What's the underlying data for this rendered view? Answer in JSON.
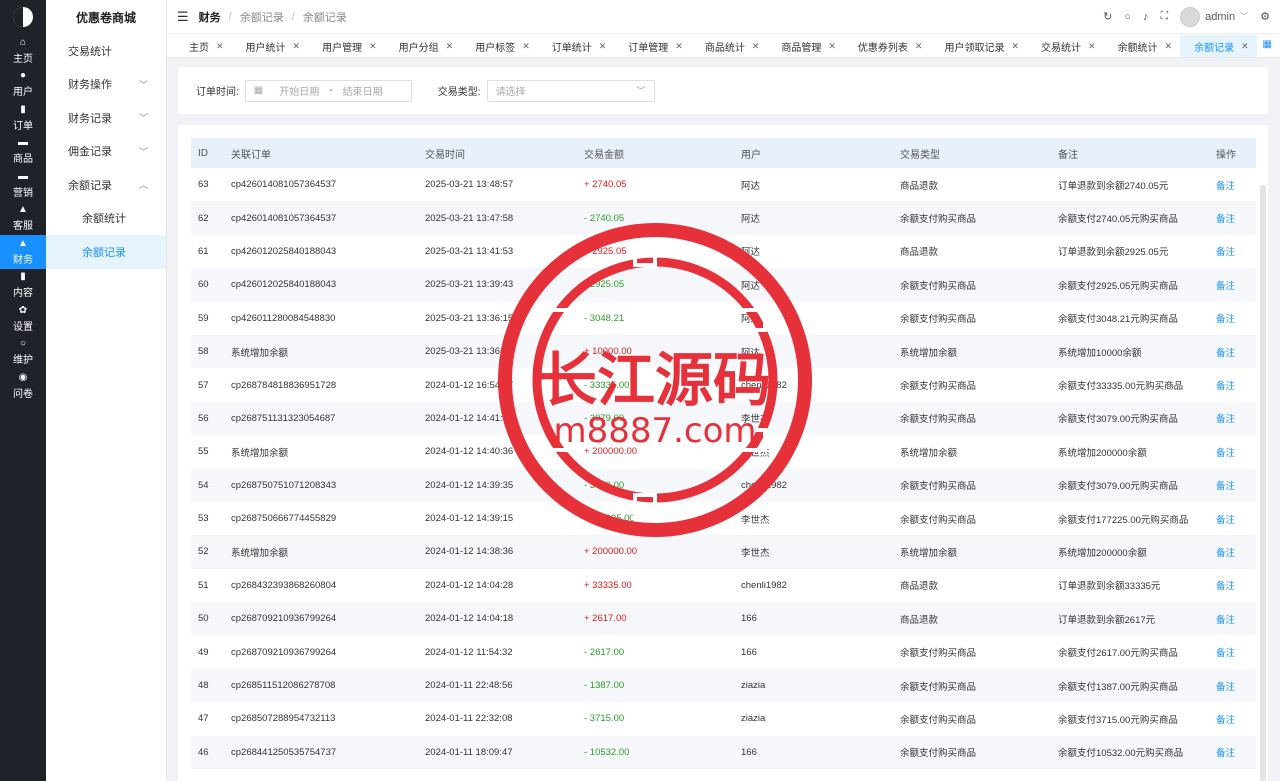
{
  "rail": {
    "logo_icon": "logo-icon",
    "items": [
      {
        "label": "主页",
        "icon": "⌂"
      },
      {
        "label": "用户",
        "icon": "●"
      },
      {
        "label": "订单",
        "icon": "▮"
      },
      {
        "label": "商品",
        "icon": "▬"
      },
      {
        "label": "营销",
        "icon": "▬"
      },
      {
        "label": "客服",
        "icon": "▲"
      },
      {
        "label": "财务",
        "icon": "▲"
      },
      {
        "label": "内容",
        "icon": "▮"
      },
      {
        "label": "设置",
        "icon": "✿"
      },
      {
        "label": "维护",
        "icon": "○"
      },
      {
        "label": "问卷",
        "icon": "◉"
      }
    ],
    "active_index": 6
  },
  "submenu": {
    "brand": "优惠卷商城",
    "items": [
      {
        "label": "交易统计",
        "chevron": ""
      },
      {
        "label": "财务操作",
        "chevron": "﹀"
      },
      {
        "label": "财务记录",
        "chevron": "﹀"
      },
      {
        "label": "佣金记录",
        "chevron": "﹀"
      },
      {
        "label": "余额记录",
        "chevron": "︿"
      },
      {
        "label": "余额统计",
        "chevron": ""
      },
      {
        "label": "余额记录",
        "chevron": ""
      }
    ]
  },
  "header": {
    "menu_icon": "☰",
    "crumbs": [
      "财务",
      "余额记录",
      "余额记录"
    ],
    "crumb_sep": "/",
    "icons": {
      "refresh": "↻",
      "search": "○",
      "bell": "♪",
      "fullscreen": "⛶",
      "settings": "⚙"
    },
    "user": "admin",
    "user_chevron": "﹀"
  },
  "tabs": {
    "close": "✕",
    "grid_icon": "▦",
    "items": [
      "主页",
      "用户统计",
      "用户管理",
      "用户分组",
      "用户标签",
      "订单统计",
      "订单管理",
      "商品统计",
      "商品管理",
      "优惠券列表",
      "用户领取记录",
      "交易统计",
      "余额统计",
      "余额记录"
    ],
    "active_index": 13
  },
  "filter": {
    "order_time_label": "订单时间:",
    "cal_icon": "▦",
    "start_placeholder": "开始日期",
    "dash": "-",
    "end_placeholder": "结束日期",
    "type_label": "交易类型:",
    "type_placeholder": "请选择",
    "type_chevron": "﹀"
  },
  "table": {
    "columns": [
      "ID",
      "关联订单",
      "交易时间",
      "交易金额",
      "用户",
      "交易类型",
      "备注",
      "操作"
    ],
    "rows": [
      {
        "id": "63",
        "order": "cp426014081057364537",
        "time": "2025-03-21 13:48:57",
        "amount": "+ 2740.05",
        "sign": "plus",
        "user": "阿达",
        "type": "商品退款",
        "note": "订单退款到余额2740.05元",
        "op": "备注"
      },
      {
        "id": "62",
        "order": "cp426014081057364537",
        "time": "2025-03-21 13:47:58",
        "amount": "- 2740.05",
        "sign": "minus",
        "user": "阿达",
        "type": "余额支付购买商品",
        "note": "余额支付2740.05元购买商品",
        "op": "备注"
      },
      {
        "id": "61",
        "order": "cp426012025840188043",
        "time": "2025-03-21 13:41:53",
        "amount": "+ 2925.05",
        "sign": "plus",
        "user": "阿达",
        "type": "商品退款",
        "note": "订单退款到余额2925.05元",
        "op": "备注"
      },
      {
        "id": "60",
        "order": "cp426012025840188043",
        "time": "2025-03-21 13:39:43",
        "amount": "- 2925.05",
        "sign": "minus",
        "user": "阿达",
        "type": "余额支付购买商品",
        "note": "余额支付2925.05元购买商品",
        "op": "备注"
      },
      {
        "id": "59",
        "order": "cp426011280084548830",
        "time": "2025-03-21 13:36:15",
        "amount": "- 3048.21",
        "sign": "minus",
        "user": "阿达",
        "type": "余额支付购买商品",
        "note": "余额支付3048.21元购买商品",
        "op": "备注"
      },
      {
        "id": "58",
        "order": "系统增加余额",
        "time": "2025-03-21 13:36:17",
        "amount": "+ 10000.00",
        "sign": "plus",
        "user": "阿达",
        "type": "系统增加余额",
        "note": "系统增加10000余额",
        "op": "备注"
      },
      {
        "id": "57",
        "order": "cp268784818836951728",
        "time": "2024-01-12 16:54:57",
        "amount": "- 33335.00",
        "sign": "minus",
        "user": "chenli1982",
        "type": "余额支付购买商品",
        "note": "余额支付33335.00元购买商品",
        "op": "备注"
      },
      {
        "id": "56",
        "order": "cp268751131323054687",
        "time": "2024-01-12 14:41:05",
        "amount": "- 3079.00",
        "sign": "minus",
        "user": "李世杰",
        "type": "余额支付购买商品",
        "note": "余额支付3079.00元购买商品",
        "op": "备注"
      },
      {
        "id": "55",
        "order": "系统增加余额",
        "time": "2024-01-12 14:40:36",
        "amount": "+ 200000.00",
        "sign": "plus",
        "user": "李世杰",
        "type": "系统增加余额",
        "note": "系统增加200000余额",
        "op": "备注"
      },
      {
        "id": "54",
        "order": "cp268750751071208343",
        "time": "2024-01-12 14:39:35",
        "amount": "- 3079.00",
        "sign": "minus",
        "user": "chenli1982",
        "type": "余额支付购买商品",
        "note": "余额支付3079.00元购买商品",
        "op": "备注"
      },
      {
        "id": "53",
        "order": "cp268750666774455829",
        "time": "2024-01-12 14:39:15",
        "amount": "- 177225.00",
        "sign": "minus",
        "user": "李世杰",
        "type": "余额支付购买商品",
        "note": "余额支付177225.00元购买商品",
        "op": "备注"
      },
      {
        "id": "52",
        "order": "系统增加余额",
        "time": "2024-01-12 14:38:36",
        "amount": "+ 200000.00",
        "sign": "plus",
        "user": "李世杰",
        "type": "系统增加余额",
        "note": "系统增加200000余额",
        "op": "备注"
      },
      {
        "id": "51",
        "order": "cp268432393868260804",
        "time": "2024-01-12 14:04:28",
        "amount": "+ 33335.00",
        "sign": "plus",
        "user": "chenli1982",
        "type": "商品退款",
        "note": "订单退款到余额33335元",
        "op": "备注"
      },
      {
        "id": "50",
        "order": "cp268709210936799264",
        "time": "2024-01-12 14:04:18",
        "amount": "+ 2617.00",
        "sign": "plus",
        "user": "166",
        "type": "商品退款",
        "note": "订单退款到余额2617元",
        "op": "备注"
      },
      {
        "id": "49",
        "order": "cp268709210936799264",
        "time": "2024-01-12 11:54:32",
        "amount": "- 2617.00",
        "sign": "minus",
        "user": "166",
        "type": "余额支付购买商品",
        "note": "余额支付2617.00元购买商品",
        "op": "备注"
      },
      {
        "id": "48",
        "order": "cp268511512086278708",
        "time": "2024-01-11 22:48:56",
        "amount": "- 1387.00",
        "sign": "minus",
        "user": "ziazia",
        "type": "余额支付购买商品",
        "note": "余额支付1387.00元购买商品",
        "op": "备注"
      },
      {
        "id": "47",
        "order": "cp268507288954732113",
        "time": "2024-01-11 22:32:08",
        "amount": "- 3715.00",
        "sign": "minus",
        "user": "ziazia",
        "type": "余额支付购买商品",
        "note": "余额支付3715.00元购买商品",
        "op": "备注"
      },
      {
        "id": "46",
        "order": "cp268441250535754737",
        "time": "2024-01-11 18:09:47",
        "amount": "- 10532.00",
        "sign": "minus",
        "user": "166",
        "type": "余额支付购买商品",
        "note": "余额支付10532.00元购买商品",
        "op": "备注"
      }
    ]
  },
  "watermark": {
    "line1": "长江源码",
    "line2": "m8887.com",
    "color": "#e6303a"
  }
}
